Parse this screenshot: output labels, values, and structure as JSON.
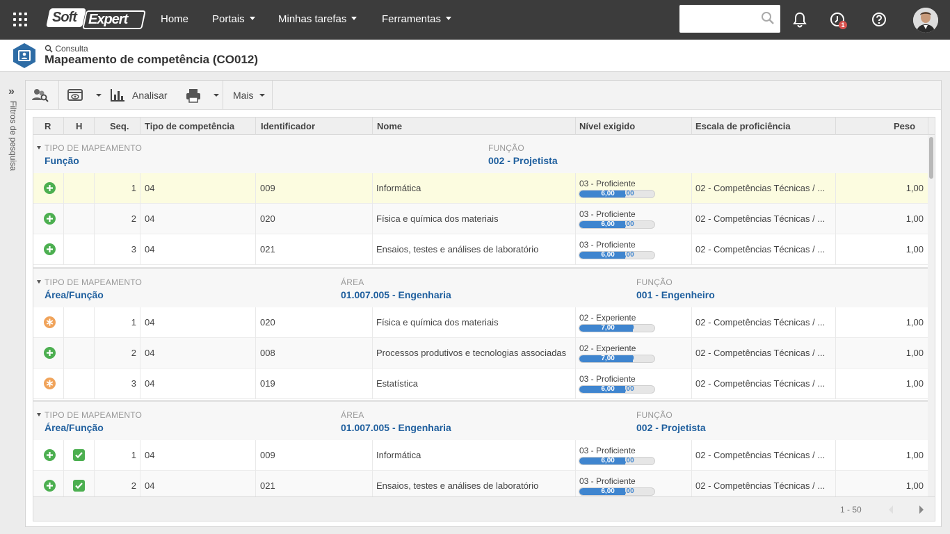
{
  "topbar": {
    "logo_soft": "Soft",
    "logo_expert": "Expert",
    "nav": [
      {
        "label": "Home"
      },
      {
        "label": "Portais"
      },
      {
        "label": "Minhas tarefas"
      },
      {
        "label": "Ferramentas"
      }
    ],
    "search_placeholder": "",
    "notification_badge": "1"
  },
  "header": {
    "breadcrumb": "Consulta",
    "title": "Mapeamento de competência (CO012)"
  },
  "sidepanel": {
    "label": "Filtros de pesquisa"
  },
  "toolbar": {
    "analyze_label": "Analisar",
    "more_label": "Mais"
  },
  "grid": {
    "columns": [
      "R",
      "H",
      "Seq.",
      "Tipo de competência",
      "Identificador",
      "Nome",
      "Nível exigido",
      "Escala de proficiência",
      "Peso"
    ],
    "groups": [
      {
        "fields": [
          {
            "label": "TIPO DE MAPEAMENTO",
            "value": "Função"
          },
          {
            "label": "FUNÇÃO",
            "value": "002 - Projetista"
          }
        ],
        "rows": [
          {
            "r": "plus",
            "h": false,
            "seq": "1",
            "tipo": "04",
            "id": "009",
            "nome": "Informática",
            "nivel": "03 - Proficiente",
            "bar_a": "6,00",
            "bar_b": "/10,00",
            "progress": 0.6,
            "escala": "02 - Competências Técnicas / ...",
            "peso": "1,00"
          },
          {
            "r": "plus",
            "h": false,
            "seq": "2",
            "tipo": "04",
            "id": "020",
            "nome": "Física e química dos materiais",
            "nivel": "03 - Proficiente",
            "bar_a": "6,00",
            "bar_b": "/10,00",
            "progress": 0.6,
            "escala": "02 - Competências Técnicas / ...",
            "peso": "1,00"
          },
          {
            "r": "plus",
            "h": false,
            "seq": "3",
            "tipo": "04",
            "id": "021",
            "nome": "Ensaios, testes e análises de laboratório",
            "nivel": "03 - Proficiente",
            "bar_a": "6,00",
            "bar_b": "/10,00",
            "progress": 0.6,
            "escala": "02 - Competências Técnicas / ...",
            "peso": "1,00"
          }
        ]
      },
      {
        "fields": [
          {
            "label": "TIPO DE MAPEAMENTO",
            "value": "Área/Função"
          },
          {
            "label": "ÁREA",
            "value": "01.007.005 - Engenharia"
          },
          {
            "label": "FUNÇÃO",
            "value": "001 - Engenheiro"
          }
        ],
        "rows": [
          {
            "r": "star",
            "h": false,
            "seq": "1",
            "tipo": "04",
            "id": "020",
            "nome": "Física e química dos materiais",
            "nivel": "02 - Experiente",
            "bar_a": "7,00",
            "bar_b": "/10,00",
            "progress": 0.7,
            "escala": "02 - Competências Técnicas / ...",
            "peso": "1,00"
          },
          {
            "r": "plus",
            "h": false,
            "seq": "2",
            "tipo": "04",
            "id": "008",
            "nome": "Processos produtivos e tecnologias associadas",
            "nivel": "02 - Experiente",
            "bar_a": "7,00",
            "bar_b": "/10,00",
            "progress": 0.7,
            "escala": "02 - Competências Técnicas / ...",
            "peso": "1,00"
          },
          {
            "r": "star",
            "h": false,
            "seq": "3",
            "tipo": "04",
            "id": "019",
            "nome": "Estatística",
            "nivel": "03 - Proficiente",
            "bar_a": "6,00",
            "bar_b": "/10,00",
            "progress": 0.6,
            "escala": "02 - Competências Técnicas / ...",
            "peso": "1,00"
          }
        ]
      },
      {
        "fields": [
          {
            "label": "TIPO DE MAPEAMENTO",
            "value": "Área/Função"
          },
          {
            "label": "ÁREA",
            "value": "01.007.005 - Engenharia"
          },
          {
            "label": "FUNÇÃO",
            "value": "002 - Projetista"
          }
        ],
        "rows": [
          {
            "r": "plus",
            "h": true,
            "seq": "1",
            "tipo": "04",
            "id": "009",
            "nome": "Informática",
            "nivel": "03 - Proficiente",
            "bar_a": "6,00",
            "bar_b": "/10,00",
            "progress": 0.6,
            "escala": "02 - Competências Técnicas / ...",
            "peso": "1,00"
          },
          {
            "r": "plus",
            "h": true,
            "seq": "2",
            "tipo": "04",
            "id": "021",
            "nome": "Ensaios, testes e análises de laboratório",
            "nivel": "03 - Proficiente",
            "bar_a": "6,00",
            "bar_b": "/10,00",
            "progress": 0.6,
            "escala": "02 - Competências Técnicas / ...",
            "peso": "1,00"
          }
        ]
      }
    ],
    "pagination": "1 - 50"
  },
  "colors": {
    "topbar": "#3c3c3c",
    "link_blue": "#1f5f9e",
    "progress_blue": "#3f85cf",
    "add_green": "#4caf50",
    "star_orange": "#f0a35a",
    "highlight_row": "#fcfce0"
  }
}
